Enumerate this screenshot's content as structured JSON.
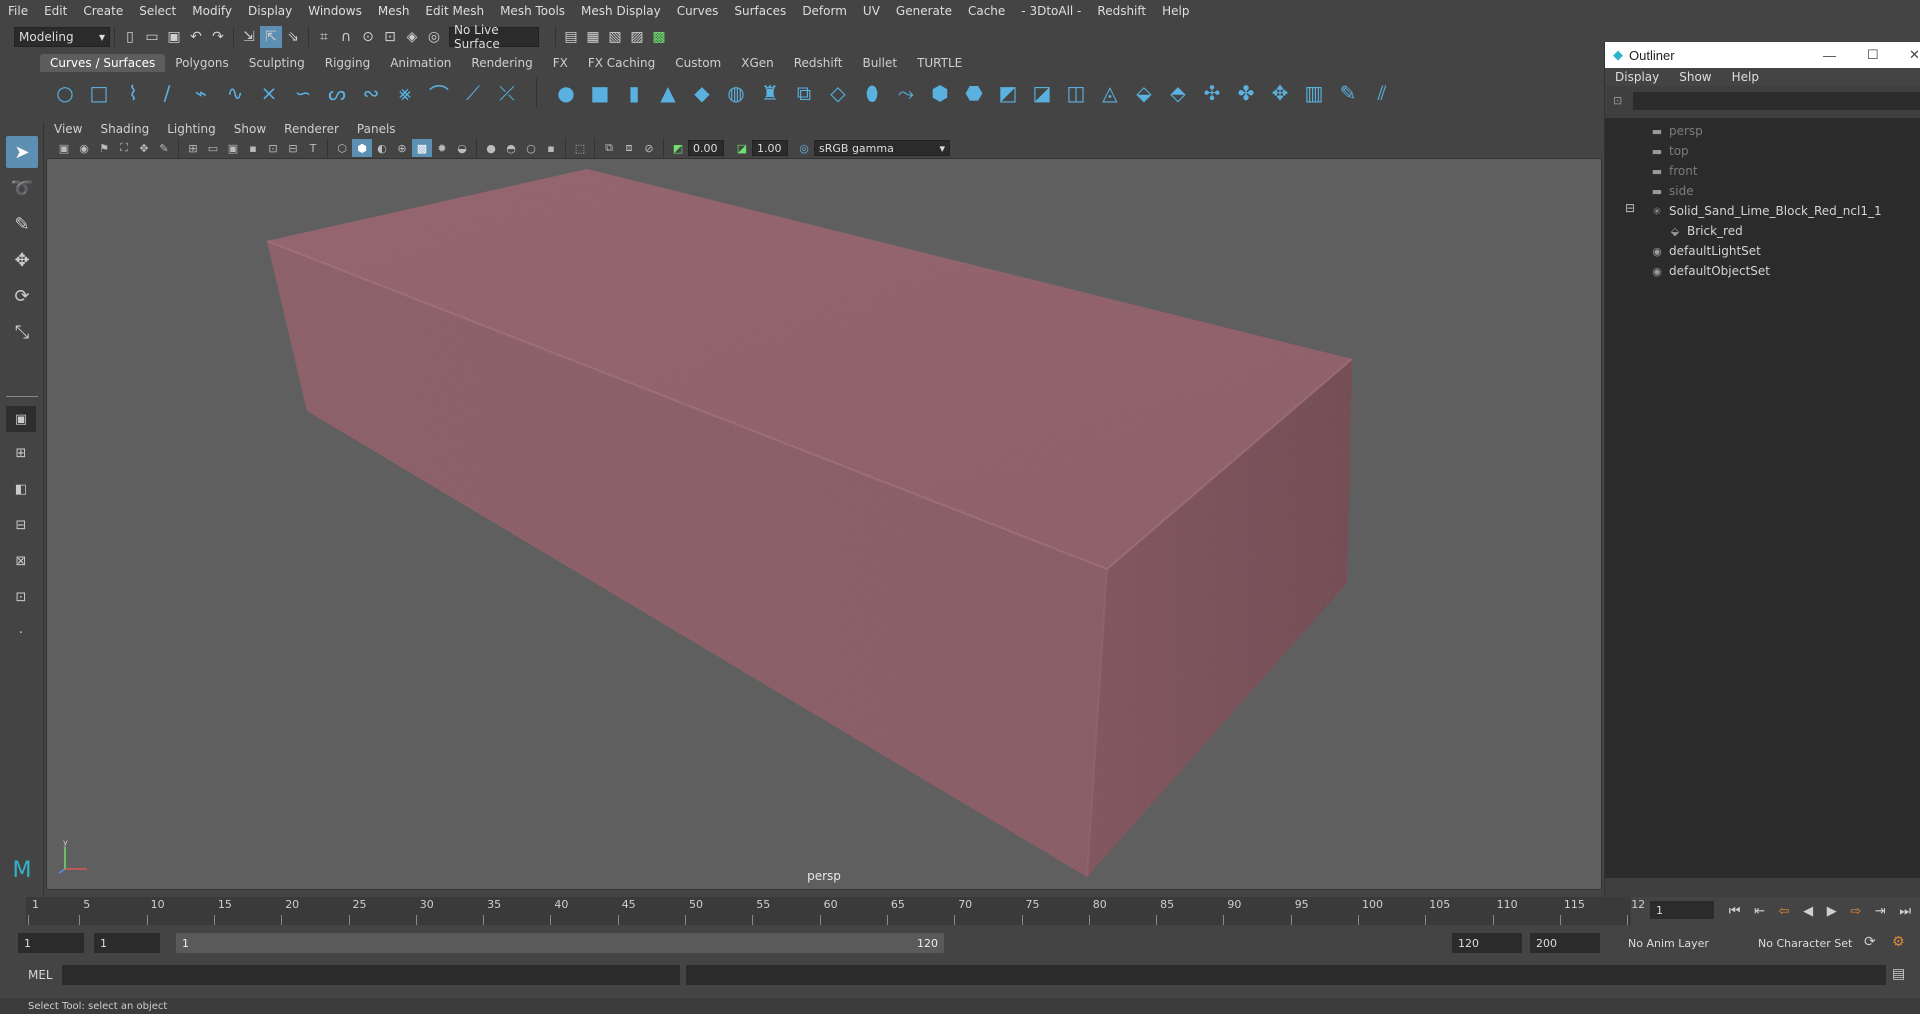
{
  "menubar": {
    "items": [
      "File",
      "Edit",
      "Create",
      "Select",
      "Modify",
      "Display",
      "Windows",
      "Mesh",
      "Edit Mesh",
      "Mesh Tools",
      "Mesh Display",
      "Curves",
      "Surfaces",
      "Deform",
      "UV",
      "Generate",
      "Cache",
      "- 3DtoAll -",
      "Redshift",
      "Help"
    ]
  },
  "statusline": {
    "menuset": "Modeling",
    "live_surface": "No Live Surface"
  },
  "shelf": {
    "tabs": [
      "Curves / Surfaces",
      "Polygons",
      "Sculpting",
      "Rigging",
      "Animation",
      "Rendering",
      "FX",
      "FX Caching",
      "Custom",
      "XGen",
      "Redshift",
      "Bullet",
      "TURTLE"
    ],
    "active_tab": "Curves / Surfaces"
  },
  "panel": {
    "menus": [
      "View",
      "Shading",
      "Lighting",
      "Show",
      "Renderer",
      "Panels"
    ],
    "exposure": "0.00",
    "gamma": "1.00",
    "colorspace": "sRGB gamma",
    "camera_label": "persp"
  },
  "outliner": {
    "title": "Outliner",
    "menus": [
      "Display",
      "Show",
      "Help"
    ],
    "nodes": [
      {
        "label": "persp",
        "dim": true
      },
      {
        "label": "top",
        "dim": true
      },
      {
        "label": "front",
        "dim": true
      },
      {
        "label": "side",
        "dim": true
      },
      {
        "label": "Solid_Sand_Lime_Block_Red_ncl1_1",
        "dim": false
      },
      {
        "label": "Brick_red",
        "dim": false
      },
      {
        "label": "defaultLightSet",
        "dim": false
      },
      {
        "label": "defaultObjectSet",
        "dim": false
      }
    ]
  },
  "timeline": {
    "ticks": [
      "1",
      "5",
      "10",
      "15",
      "20",
      "25",
      "30",
      "35",
      "40",
      "45",
      "50",
      "55",
      "60",
      "65",
      "70",
      "75",
      "80",
      "85",
      "90",
      "95",
      "100",
      "105",
      "110",
      "115",
      "12"
    ],
    "current_frame": "1"
  },
  "range": {
    "start": "1",
    "playback_start": "1",
    "slider_start": "1",
    "slider_end": "120",
    "playback_end": "120",
    "end": "200",
    "anim_layer": "No Anim Layer",
    "character_set": "No Character Set"
  },
  "command": {
    "label": "MEL"
  },
  "helpline": {
    "text": "Select Tool: select an object"
  },
  "colors": {
    "accent": "#5ab1e0",
    "brick": "#8a5560",
    "viewport_bg": "#5f5f5f"
  }
}
